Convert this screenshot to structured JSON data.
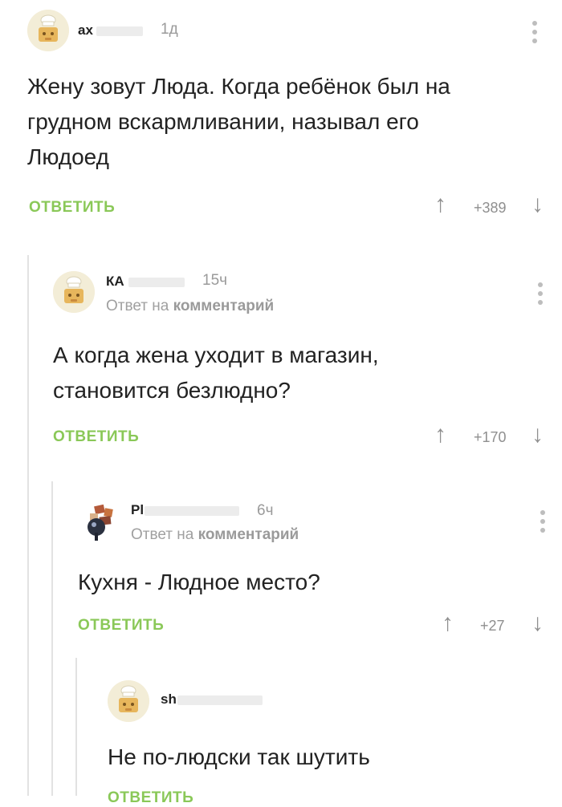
{
  "comments": [
    {
      "username": "ax",
      "time": "1д",
      "reply_to_prefix": "",
      "reply_to_bold": "",
      "text_lines": [
        "Жену зовут Люда. Когда ребёнок был на",
        "грудном вскармливании, называл его",
        "Людоед"
      ],
      "reply_label": "ОТВЕТИТЬ",
      "score": "+389"
    },
    {
      "username": "КА",
      "time": "15ч",
      "reply_to_prefix": "Ответ на ",
      "reply_to_bold": "комментарий",
      "text_lines": [
        "А когда жена уходит в магазин,",
        "становится безлюдно?"
      ],
      "reply_label": "ОТВЕТИТЬ",
      "score": "+170"
    },
    {
      "username": "Pl",
      "time": "6ч",
      "reply_to_prefix": "Ответ на ",
      "reply_to_bold": "комментарий",
      "text_lines": [
        "Кухня - Людное место?"
      ],
      "reply_label": "ОТВЕТИТЬ",
      "score": "+27"
    },
    {
      "username": "sh",
      "time": "",
      "text_lines": [
        "Не по-людски так шутить"
      ],
      "reply_label": "ОТВЕТИТЬ"
    }
  ],
  "icons": {
    "avatar_default": "chef-hat-avatar-icon",
    "vote_up": "arrow-up-icon",
    "vote_down": "arrow-down-icon",
    "menu": "more-vertical-icon"
  },
  "colors": {
    "reply_green": "#8ac858",
    "muted_gray": "#9a9a9a",
    "thread_line": "#e2e2e2"
  }
}
